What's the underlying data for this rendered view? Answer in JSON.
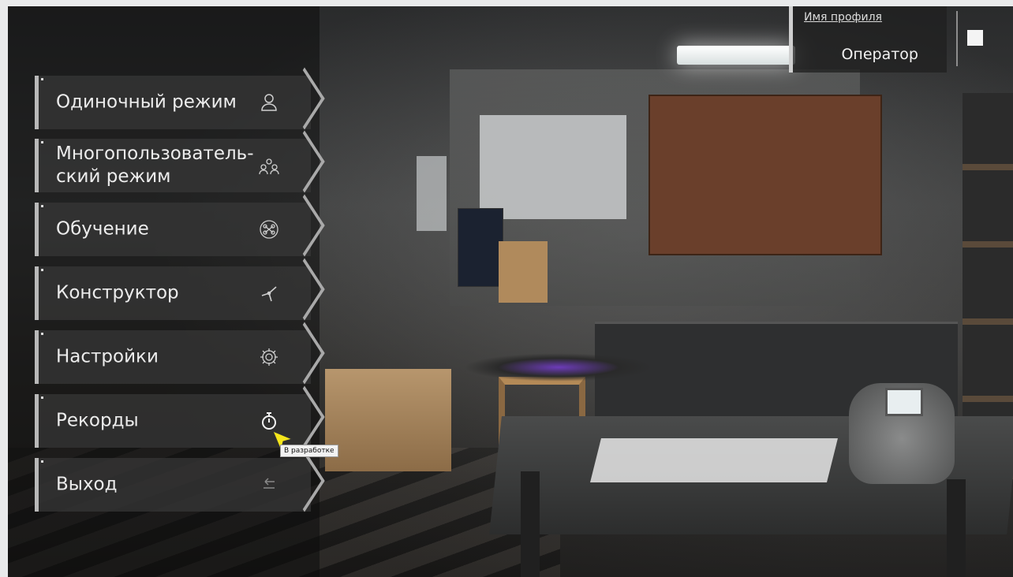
{
  "menu": {
    "items": [
      {
        "label": "Одиночный режим",
        "icon": "single-user-icon"
      },
      {
        "label": "Многопользователь-\nский режим",
        "icon": "multi-user-icon"
      },
      {
        "label": "Обучение",
        "icon": "training-drone-icon"
      },
      {
        "label": "Конструктор",
        "icon": "propeller-icon"
      },
      {
        "label": "Настройки",
        "icon": "gear-icon"
      },
      {
        "label": "Рекорды",
        "icon": "stopwatch-icon"
      },
      {
        "label": "Выход",
        "icon": "exit-arrow-icon"
      }
    ]
  },
  "tooltip": "В разработке",
  "profile": {
    "label": "Имя профиля",
    "name": "Оператор"
  },
  "colors": {
    "menu_item_bg": "#373737",
    "menu_accent": "#b9b9b9",
    "text": "#ececec"
  }
}
